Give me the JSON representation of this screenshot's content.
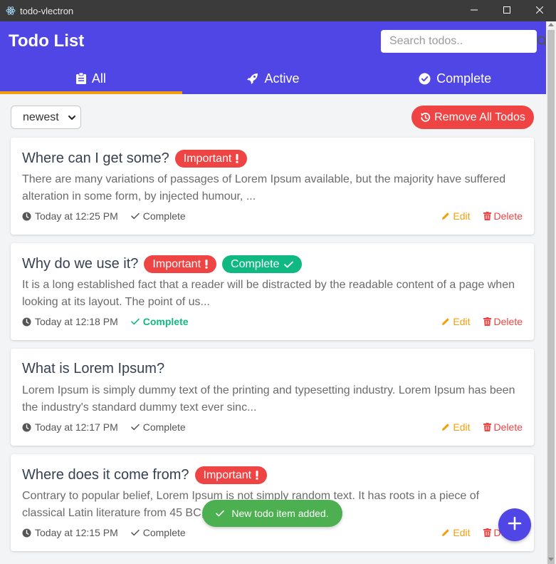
{
  "window": {
    "title": "todo-vlectron",
    "app_icon": "electron-icon",
    "controls": [
      "minimize-icon",
      "maximize-icon",
      "close-icon"
    ]
  },
  "header": {
    "title": "Todo List",
    "search": {
      "placeholder": "Search todos..",
      "value": ""
    }
  },
  "tabs": [
    {
      "label": "All",
      "icon": "clipboard-icon",
      "active": true
    },
    {
      "label": "Active",
      "icon": "rocket-icon",
      "active": false
    },
    {
      "label": "Complete",
      "icon": "check-circle-icon",
      "active": false
    }
  ],
  "toolbar": {
    "sort_value": "newest",
    "remove_all_label": "Remove All Todos"
  },
  "todos": [
    {
      "title": "Where can I get some?",
      "important": true,
      "completed": false,
      "description": "There are many variations of passages of Lorem Ipsum available, but the majority have suffered alteration in some form, by injected humour, ...",
      "time": "Today at 12:25 PM",
      "status_label": "Complete"
    },
    {
      "title": "Why do we use it?",
      "important": true,
      "completed": true,
      "description": "It is a long established fact that a reader will be distracted by the readable content of a page when looking at its layout. The point of us...",
      "time": "Today at 12:18 PM",
      "status_label": "Complete"
    },
    {
      "title": "What is Lorem Ipsum?",
      "important": false,
      "completed": false,
      "description": "Lorem Ipsum is simply dummy text of the printing and typesetting industry. Lorem Ipsum has been the industry's standard dummy text ever sinc...",
      "time": "Today at 12:17 PM",
      "status_label": "Complete"
    },
    {
      "title": "Where does it come from?",
      "important": true,
      "completed": false,
      "description": "Contrary to popular belief, Lorem Ipsum is not simply random text. It has roots in a piece of classical Latin literature from 45 BC, ...",
      "time": "Today at 12:15 PM",
      "status_label": "Complete"
    }
  ],
  "labels": {
    "important": "Important",
    "complete_badge": "Complete",
    "edit": "Edit",
    "delete": "Delete"
  },
  "toast": {
    "message": "New todo item added."
  },
  "colors": {
    "primary": "#5046e5",
    "accent": "#f59e0b",
    "danger": "#ef4444",
    "success": "#10b981",
    "toast": "#4caf50"
  }
}
